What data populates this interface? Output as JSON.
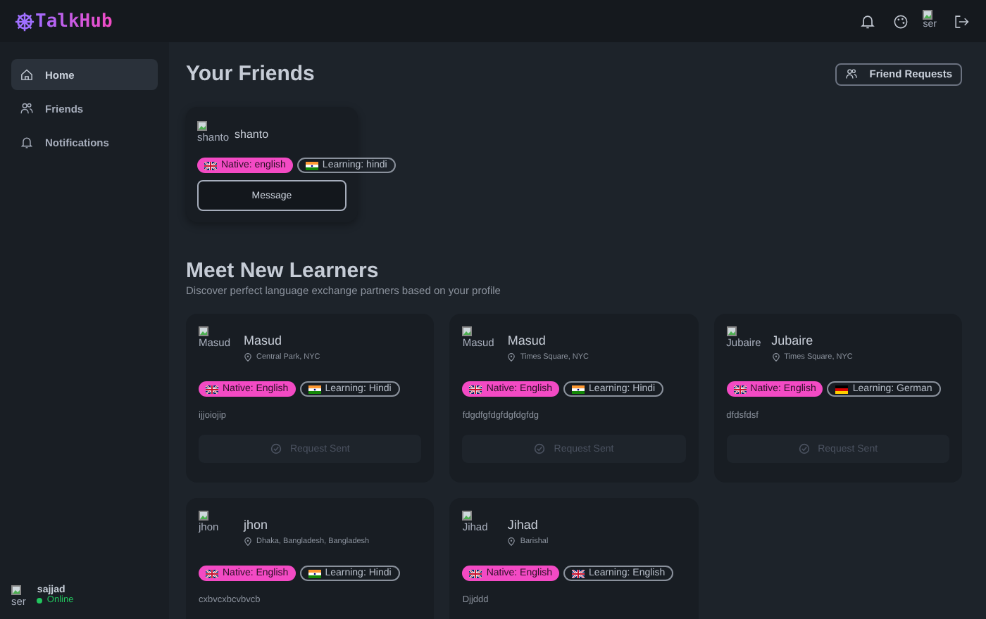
{
  "header": {
    "logo": "TalkHub",
    "avatar_alt": "ser"
  },
  "sidebar": {
    "items": [
      {
        "label": "Home",
        "selected": true
      },
      {
        "label": "Friends",
        "selected": false
      },
      {
        "label": "Notifications",
        "selected": false
      }
    ],
    "user": {
      "avatar_alt": "ser",
      "name": "sajjad",
      "status": "Online"
    }
  },
  "friends": {
    "title": "Your Friends",
    "requests_button": "Friend Requests",
    "cards": [
      {
        "avatar_alt": "shanto",
        "name": "shanto",
        "native": {
          "label": "Native: english",
          "kind": "uk"
        },
        "learning": {
          "label": "Learning: hindi",
          "kind": "in"
        },
        "button": "Message"
      }
    ]
  },
  "learners": {
    "title": "Meet New Learners",
    "subtitle": "Discover perfect language exchange partners based on your profile",
    "cards": [
      {
        "avatar_alt": "Masud",
        "name": "Masud",
        "location": "Central Park, NYC",
        "native": {
          "label": "Native: English",
          "kind": "uk"
        },
        "learning": {
          "label": "Learning: Hindi",
          "kind": "in"
        },
        "bio": "ijjoiojip",
        "button": "Request Sent",
        "request_sent": true
      },
      {
        "avatar_alt": "Masud",
        "name": "Masud",
        "location": "Times Square, NYC",
        "native": {
          "label": "Native: English",
          "kind": "uk"
        },
        "learning": {
          "label": "Learning: Hindi",
          "kind": "in"
        },
        "bio": "fdgdfgfdgfdgfdgfdg",
        "button": "Request Sent",
        "request_sent": true
      },
      {
        "avatar_alt": "Jubaire",
        "name": "Jubaire",
        "location": "Times Square, NYC",
        "native": {
          "label": "Native: English",
          "kind": "uk"
        },
        "learning": {
          "label": "Learning: German",
          "kind": "de"
        },
        "bio": "dfdsfdsf",
        "button": "Request Sent",
        "request_sent": true
      },
      {
        "avatar_alt": "jhon",
        "name": "jhon",
        "location": "Dhaka, Bangladesh, Bangladesh",
        "native": {
          "label": "Native: English",
          "kind": "uk"
        },
        "learning": {
          "label": "Learning: Hindi",
          "kind": "in"
        },
        "bio": "cxbvcxbcvbvcb"
      },
      {
        "avatar_alt": "Jihad",
        "name": "Jihad",
        "location": "Barishal",
        "native": {
          "label": "Native: English",
          "kind": "uk"
        },
        "learning": {
          "label": "Learning: English",
          "kind": "uk"
        },
        "bio": "Djjddd"
      }
    ]
  }
}
